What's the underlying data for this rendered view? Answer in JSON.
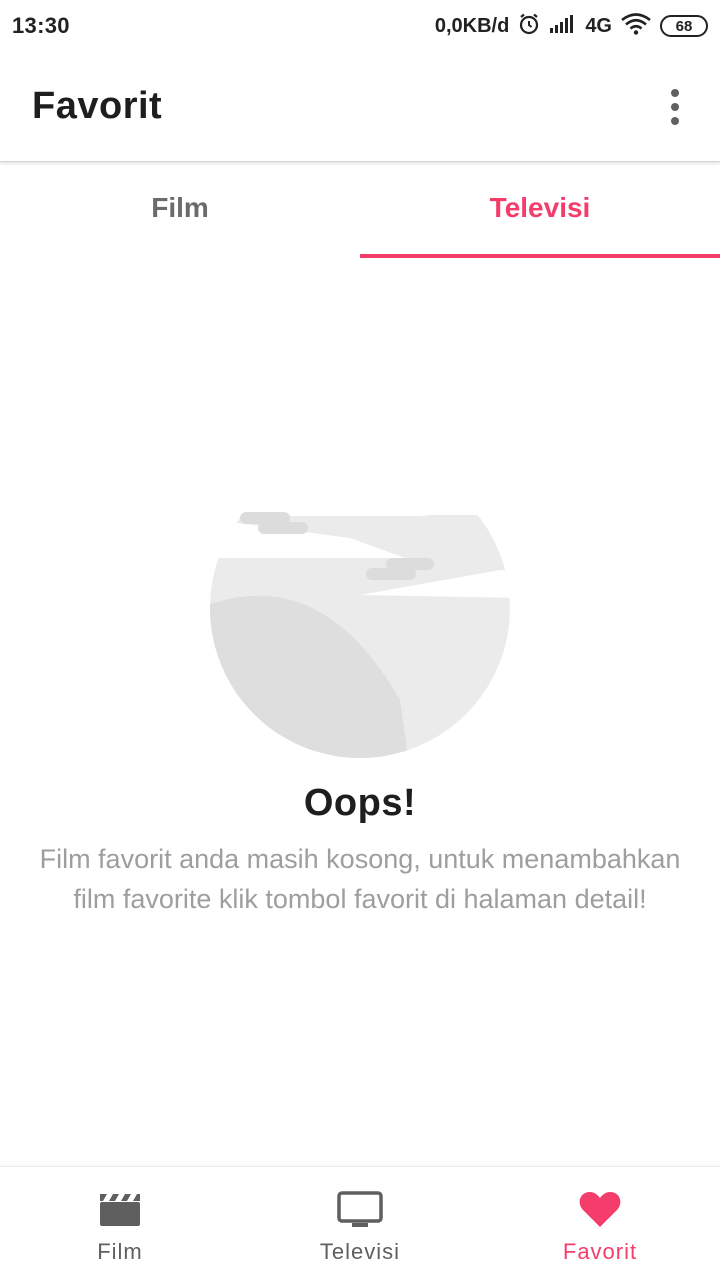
{
  "status_bar": {
    "time": "13:30",
    "speed": "0,0KB/d",
    "network": "4G",
    "battery": "68",
    "icons": [
      "alarm-icon",
      "signal-icon",
      "wifi-icon",
      "battery-icon"
    ]
  },
  "app_bar": {
    "title": "Favorit",
    "menu_icon": "more-vert-icon"
  },
  "tabs": [
    {
      "label": "Film",
      "selected": false
    },
    {
      "label": "Televisi",
      "selected": true
    }
  ],
  "empty_state": {
    "illustration": "empty-moon-illustration",
    "title": "Oops!",
    "message": "Film favorit anda masih kosong, untuk menambahkan film favorite klik tombol favorit di halaman detail!"
  },
  "bottom_nav": {
    "items": [
      {
        "label": "Film",
        "icon": "clapperboard-icon",
        "selected": false
      },
      {
        "label": "Televisi",
        "icon": "tv-icon",
        "selected": false
      },
      {
        "label": "Favorit",
        "icon": "heart-icon",
        "selected": true
      }
    ]
  },
  "colors": {
    "accent": "#f53d6b",
    "text_primary": "#1e1e1e",
    "text_secondary": "#9e9e9e",
    "icon_inactive": "#5f5f5f"
  }
}
